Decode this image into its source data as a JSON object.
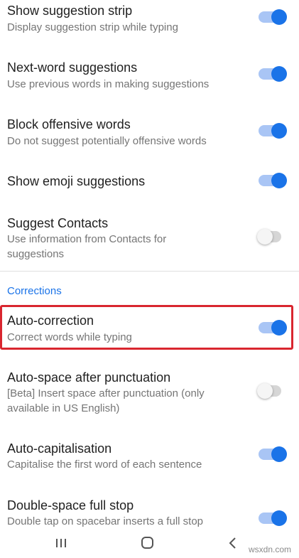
{
  "settings": [
    {
      "title": "Show suggestion strip",
      "summary": "Display suggestion strip while typing",
      "state": "on"
    },
    {
      "title": "Next-word suggestions",
      "summary": "Use previous words in making suggestions",
      "state": "on"
    },
    {
      "title": "Block offensive words",
      "summary": "Do not suggest potentially offensive words",
      "state": "on"
    },
    {
      "title": "Show emoji suggestions",
      "summary": "",
      "state": "on"
    },
    {
      "title": "Suggest Contacts",
      "summary": "Use information from Contacts for suggestions",
      "state": "off"
    }
  ],
  "corrections": {
    "header": "Corrections",
    "items": [
      {
        "title": "Auto-correction",
        "summary": "Correct words while typing",
        "state": "on",
        "highlighted": true
      },
      {
        "title": "Auto-space after punctuation",
        "summary": "[Beta] Insert space after punctuation (only available in US English)",
        "state": "off"
      },
      {
        "title": "Auto-capitalisation",
        "summary": "Capitalise the first word of each sentence",
        "state": "on"
      },
      {
        "title": "Double-space full stop",
        "summary": "Double tap on spacebar inserts a full stop",
        "state": "on"
      }
    ]
  },
  "colors": {
    "accent": "#1a73e8",
    "highlight_border": "#d9262f"
  },
  "navbar": {
    "icons": [
      "recent-apps-icon",
      "home-icon",
      "back-icon"
    ]
  },
  "watermark": "wsxdn.com"
}
